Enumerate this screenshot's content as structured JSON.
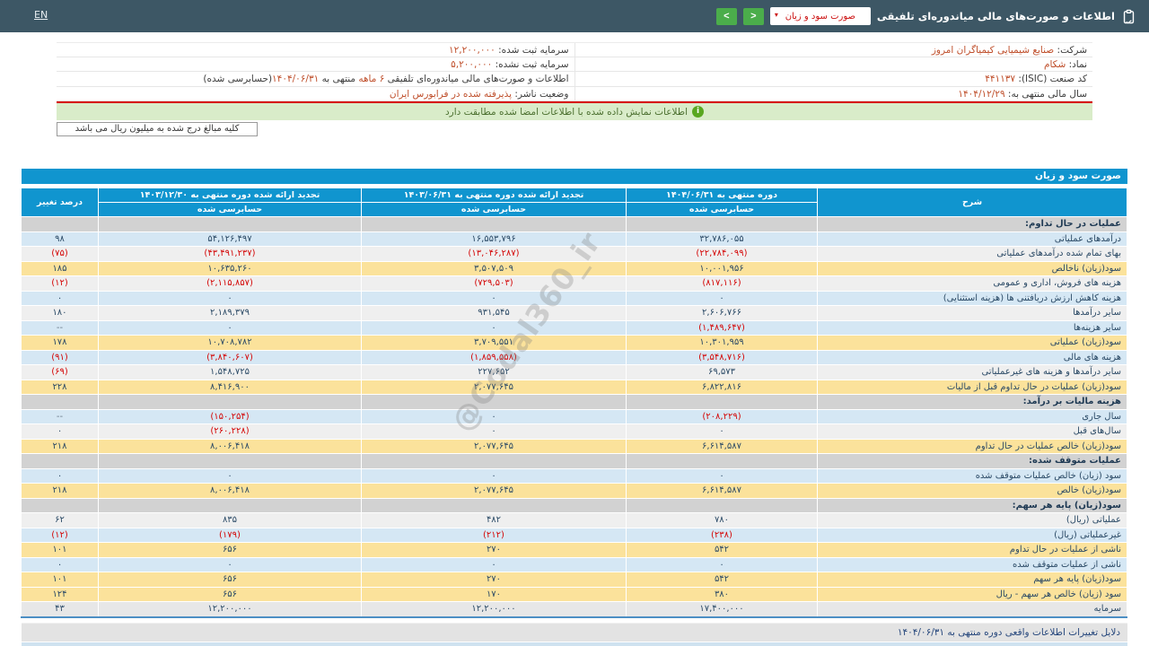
{
  "topbar": {
    "en_label": "EN",
    "title": "اطلاعات و صورت‌های مالی میاندوره‌ای تلفیقی",
    "dropdown_value": "صورت سود و زیان"
  },
  "icons": {
    "report": "clipboard-icon",
    "dropdown_chevron": "▾",
    "nav_next": ">",
    "nav_prev": "<",
    "info": "i"
  },
  "colors": {
    "topbar_teal": "#3d5765",
    "table_header_blue": "#1095cf",
    "nav_button_green": "#4bad4b",
    "row_yellow": "#fbe29b",
    "row_blue": "#d5e7f4",
    "negative_red": "#d40808",
    "info_value_orange": "#bf4e2a",
    "banner_green": "#d9ecc9",
    "red_divider": "#d60000"
  },
  "banners": {
    "signature_match": "اطلاعات نمایش داده شده با اطلاعات امضا شده مطابقت دارد",
    "amounts_note": "کلیه مبالغ درج شده به میلیون ریال می باشد"
  },
  "company_info": {
    "rows": [
      {
        "right": [
          {
            "text": "شرکت: "
          },
          {
            "text": "صنایع شیمیایی کیمیاگران امروز",
            "colored": true
          }
        ],
        "left": [
          {
            "text": "سرمایه ثبت شده: "
          },
          {
            "text": "۱۲,۲۰۰,۰۰۰",
            "colored": true
          }
        ]
      },
      {
        "right": [
          {
            "text": "نماد: "
          },
          {
            "text": "شکام",
            "colored": true
          }
        ],
        "left": [
          {
            "text": "سرمایه ثبت نشده: "
          },
          {
            "text": "۵,۲۰۰,۰۰۰",
            "colored": true
          }
        ]
      },
      {
        "right": [
          {
            "text": "کد صنعت (ISIC): "
          },
          {
            "text": "۴۴۱۱۳۷",
            "colored": true
          }
        ],
        "left": [
          {
            "text": "اطلاعات و صورت‌های مالی میاندوره‌ای تلفیقی "
          },
          {
            "text": "۶ ماهه",
            "colored": true
          },
          {
            "text": " منتهی به "
          },
          {
            "text": "۱۴۰۴/۰۶/۳۱",
            "colored": true
          },
          {
            "text": "(حسابرسی شده)"
          }
        ]
      },
      {
        "right": [
          {
            "text": "سال مالی منتهی به: "
          },
          {
            "text": "۱۴۰۴/۱۲/۲۹",
            "colored": true
          }
        ],
        "left": [
          {
            "text": "وضعیت ناشر: "
          },
          {
            "text": "پذیرفته شده در فرابورس ایران",
            "colored": true
          }
        ]
      }
    ]
  },
  "table": {
    "title": "صورت سود و زیان",
    "columns": {
      "desc": "شرح",
      "c1_text": "دوره منتهی به ",
      "c1_date": "۱۴۰۴/۰۶/۳۱",
      "c1_sub": "حسابرسی شده",
      "c2_text": "تجدید ارائه شده دوره منتهی به ",
      "c2_date": "۱۴۰۳/۰۶/۳۱",
      "c2_sub": "حسابرسی شده",
      "c3_text": "تجدید ارائه شده دوره منتهی به ",
      "c3_date": "۱۴۰۳/۱۲/۳۰",
      "c3_sub": "حسابرسی شده",
      "pct": "درصد تغییر"
    },
    "rows": [
      {
        "type": "section",
        "label": "عملیات در حال تداوم:"
      },
      {
        "type": "blue",
        "label": "درآمدهای عملیاتی",
        "v1": "۳۲,۷۸۶,۰۵۵",
        "v2": "۱۶,۵۵۳,۷۹۶",
        "v3": "۵۴,۱۲۶,۴۹۷",
        "pct": "۹۸"
      },
      {
        "type": "plain",
        "label": "بهای تمام شده درآمدهای عملیاتی",
        "v1": "(۲۲,۷۸۴,۰۹۹)",
        "v2": "(۱۳,۰۴۶,۲۸۷)",
        "v3": "(۴۳,۴۹۱,۲۳۷)",
        "pct": "(۷۵)"
      },
      {
        "type": "yellow",
        "label": "سود(زیان) ناخالص",
        "v1": "۱۰,۰۰۱,۹۵۶",
        "v2": "۳,۵۰۷,۵۰۹",
        "v3": "۱۰,۶۳۵,۲۶۰",
        "pct": "۱۸۵"
      },
      {
        "type": "plain",
        "label": "هزینه های فروش، اداری و عمومی",
        "v1": "(۸۱۷,۱۱۶)",
        "v2": "(۷۲۹,۵۰۳)",
        "v3": "(۲,۱۱۵,۸۵۷)",
        "pct": "(۱۲)"
      },
      {
        "type": "blue",
        "label": "هزینه کاهش ارزش دریافتنی ها (هزینه استثنایی)",
        "v1": "۰",
        "v2": "۰",
        "v3": "۰",
        "pct": "۰"
      },
      {
        "type": "plain",
        "label": "سایر درآمدها",
        "v1": "۲,۶۰۶,۷۶۶",
        "v2": "۹۳۱,۵۴۵",
        "v3": "۲,۱۸۹,۳۷۹",
        "pct": "۱۸۰"
      },
      {
        "type": "blue",
        "label": "سایر هزینه‌ها",
        "v1": "(۱,۴۸۹,۶۴۷)",
        "v2": "۰",
        "v3": "۰",
        "pct": "--"
      },
      {
        "type": "yellow",
        "label": "سود(زیان) عملیاتی",
        "v1": "۱۰,۳۰۱,۹۵۹",
        "v2": "۳,۷۰۹,۵۵۱",
        "v3": "۱۰,۷۰۸,۷۸۲",
        "pct": "۱۷۸"
      },
      {
        "type": "blue",
        "label": "هزینه های مالی",
        "v1": "(۳,۵۴۸,۷۱۶)",
        "v2": "(۱,۸۵۹,۵۵۸)",
        "v3": "(۳,۸۴۰,۶۰۷)",
        "pct": "(۹۱)"
      },
      {
        "type": "plain",
        "label": "سایر درآمدها و هزینه های غیرعملیاتی",
        "v1": "۶۹,۵۷۳",
        "v2": "۲۲۷,۶۵۲",
        "v3": "۱,۵۴۸,۷۲۵",
        "pct": "(۶۹)"
      },
      {
        "type": "yellow",
        "label": "سود(زیان) عملیات در حال تداوم قبل از مالیات",
        "v1": "۶,۸۲۲,۸۱۶",
        "v2": "۲,۰۷۷,۶۴۵",
        "v3": "۸,۴۱۶,۹۰۰",
        "pct": "۲۲۸"
      },
      {
        "type": "section",
        "label": "هزینه مالیات بر درآمد:"
      },
      {
        "type": "blue",
        "label": "سال جاری",
        "v1": "(۲۰۸,۲۲۹)",
        "v2": "۰",
        "v3": "(۱۵۰,۲۵۴)",
        "pct": "--"
      },
      {
        "type": "plain",
        "label": "سال‌های قبل",
        "v1": "۰",
        "v2": "۰",
        "v3": "(۲۶۰,۲۲۸)",
        "pct": "۰"
      },
      {
        "type": "yellow",
        "label": "سود(زیان) خالص عملیات در حال تداوم",
        "v1": "۶,۶۱۴,۵۸۷",
        "v2": "۲,۰۷۷,۶۴۵",
        "v3": "۸,۰۰۶,۴۱۸",
        "pct": "۲۱۸"
      },
      {
        "type": "section",
        "label": "عملیات متوقف شده:"
      },
      {
        "type": "blue",
        "label": "سود (زیان) خالص عملیات متوقف شده",
        "v1": "۰",
        "v2": "۰",
        "v3": "۰",
        "pct": "۰"
      },
      {
        "type": "yellow",
        "label": "سود(زیان) خالص",
        "v1": "۶,۶۱۴,۵۸۷",
        "v2": "۲,۰۷۷,۶۴۵",
        "v3": "۸,۰۰۶,۴۱۸",
        "pct": "۲۱۸"
      },
      {
        "type": "section",
        "label": "سود(زیان) پایه هر سهم:"
      },
      {
        "type": "plain",
        "label": "عملیاتی (ریال)",
        "v1": "۷۸۰",
        "v2": "۴۸۲",
        "v3": "۸۳۵",
        "pct": "۶۲"
      },
      {
        "type": "blue",
        "label": "غیرعملیاتی (ریال)",
        "v1": "(۲۳۸)",
        "v2": "(۲۱۲)",
        "v3": "(۱۷۹)",
        "pct": "(۱۲)"
      },
      {
        "type": "yellow",
        "label": "ناشی از عملیات در حال تداوم",
        "v1": "۵۴۲",
        "v2": "۲۷۰",
        "v3": "۶۵۶",
        "pct": "۱۰۱"
      },
      {
        "type": "blue",
        "label": "ناشی از عملیات متوقف شده",
        "v1": "۰",
        "v2": "۰",
        "v3": "۰",
        "pct": "۰"
      },
      {
        "type": "yellow",
        "label": "سود(زیان) پایه هر سهم",
        "v1": "۵۴۲",
        "v2": "۲۷۰",
        "v3": "۶۵۶",
        "pct": "۱۰۱"
      },
      {
        "type": "yellow",
        "label": "سود (زیان) خالص هر سهم - ریال",
        "v1": "۳۸۰",
        "v2": "۱۷۰",
        "v3": "۶۵۶",
        "pct": "۱۲۴"
      },
      {
        "type": "capital",
        "label": "سرمایه",
        "v1": "۱۷,۴۰۰,۰۰۰",
        "v2": "۱۲,۲۰۰,۰۰۰",
        "v3": "۱۲,۲۰۰,۰۰۰",
        "pct": "۴۳"
      }
    ]
  },
  "footer": {
    "text": "دلایل تغییرات اطلاعات واقعی دوره منتهی به ",
    "date": "۱۴۰۴/۰۶/۳۱"
  },
  "watermark": "@Codal360_ir"
}
